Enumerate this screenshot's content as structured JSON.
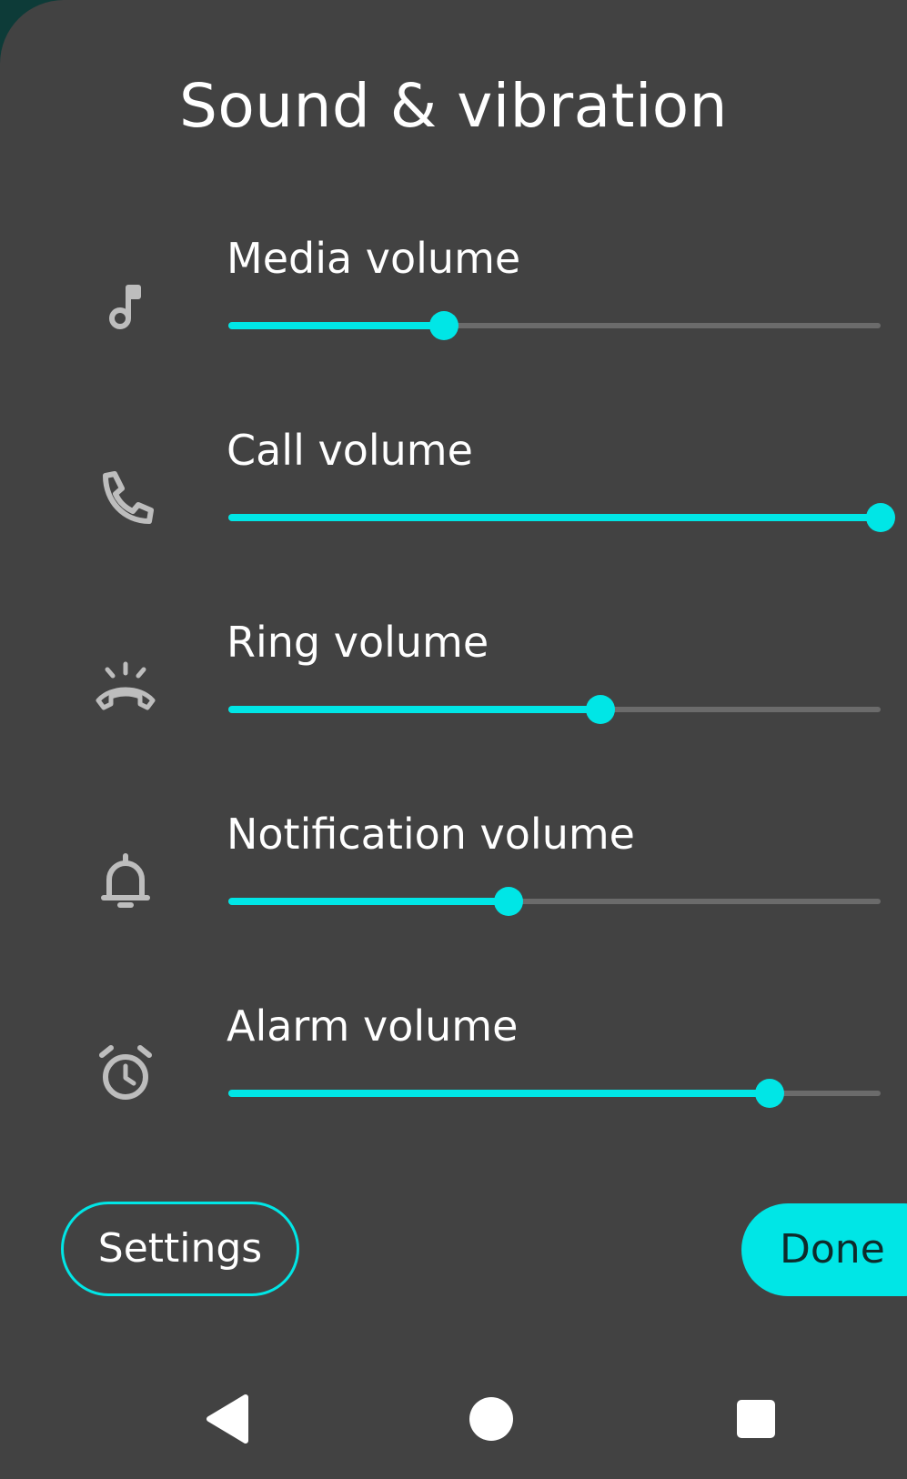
{
  "dialog": {
    "title": "Sound & vibration"
  },
  "volumes": [
    {
      "label": "Media volume",
      "icon": "music-note-icon",
      "level_percent": 33
    },
    {
      "label": "Call volume",
      "icon": "phone-icon",
      "level_percent": 100
    },
    {
      "label": "Ring volume",
      "icon": "ringing-phone-icon",
      "level_percent": 57
    },
    {
      "label": "Notification volume",
      "icon": "bell-icon",
      "level_percent": 43
    },
    {
      "label": "Alarm volume",
      "icon": "alarm-clock-icon",
      "level_percent": 83
    }
  ],
  "buttons": {
    "settings_label": "Settings",
    "done_label": "Done"
  },
  "navbar": {
    "icons": [
      "back-icon",
      "home-icon",
      "recents-icon"
    ]
  },
  "colors": {
    "accent": "#00e6e6",
    "panel": "#424242",
    "track": "#6b6b6b",
    "icon": "#bdbdbd"
  }
}
